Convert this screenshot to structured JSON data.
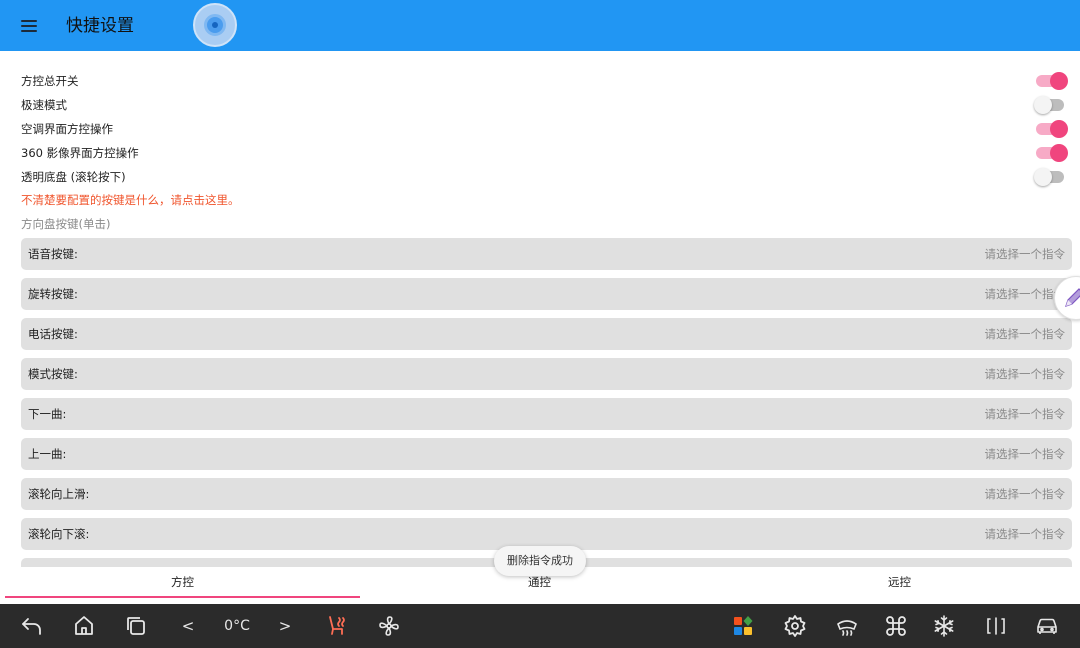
{
  "app": {
    "title": "快捷设置"
  },
  "settings": {
    "switches": [
      {
        "label": "方控总开关",
        "on": true
      },
      {
        "label": "极速模式",
        "on": false
      },
      {
        "label": "空调界面方控操作",
        "on": true
      },
      {
        "label": "360 影像界面方控操作",
        "on": true
      },
      {
        "label": "透明底盘 (滚轮按下)",
        "on": false
      }
    ],
    "hint_link": "不清楚要配置的按键是什么，请点击这里。",
    "section_title": "方向盘按键(单击)",
    "key_rows": [
      {
        "label": "语音按键:",
        "value": "请选择一个指令"
      },
      {
        "label": "旋转按键:",
        "value": "请选择一个指令"
      },
      {
        "label": "电话按键:",
        "value": "请选择一个指令"
      },
      {
        "label": "模式按键:",
        "value": "请选择一个指令"
      },
      {
        "label": "下一曲:",
        "value": "请选择一个指令"
      },
      {
        "label": "上一曲:",
        "value": "请选择一个指令"
      },
      {
        "label": "滚轮向上滑:",
        "value": "请选择一个指令"
      },
      {
        "label": "滚轮向下滚:",
        "value": "请选择一个指令"
      }
    ]
  },
  "toast": "删除指令成功",
  "tabs": [
    {
      "label": "方控",
      "active": true
    },
    {
      "label": "通控",
      "active": false
    },
    {
      "label": "远控",
      "active": false
    }
  ],
  "navbar": {
    "temperature": "0°C",
    "temp_down": "<",
    "temp_up": ">",
    "icons": [
      "back-icon",
      "home-icon",
      "recent-apps-icon",
      "seat-heat-icon",
      "fan-icon",
      "apps-grid-icon",
      "settings-gear-icon",
      "rear-defrost-icon",
      "command-icon",
      "snowflake-icon",
      "split-screen-icon",
      "car-icon"
    ]
  },
  "colors": {
    "appbar": "#2196f3",
    "accent": "#f0457e",
    "link": "#f0552d",
    "navbar": "#2b2b2b"
  }
}
